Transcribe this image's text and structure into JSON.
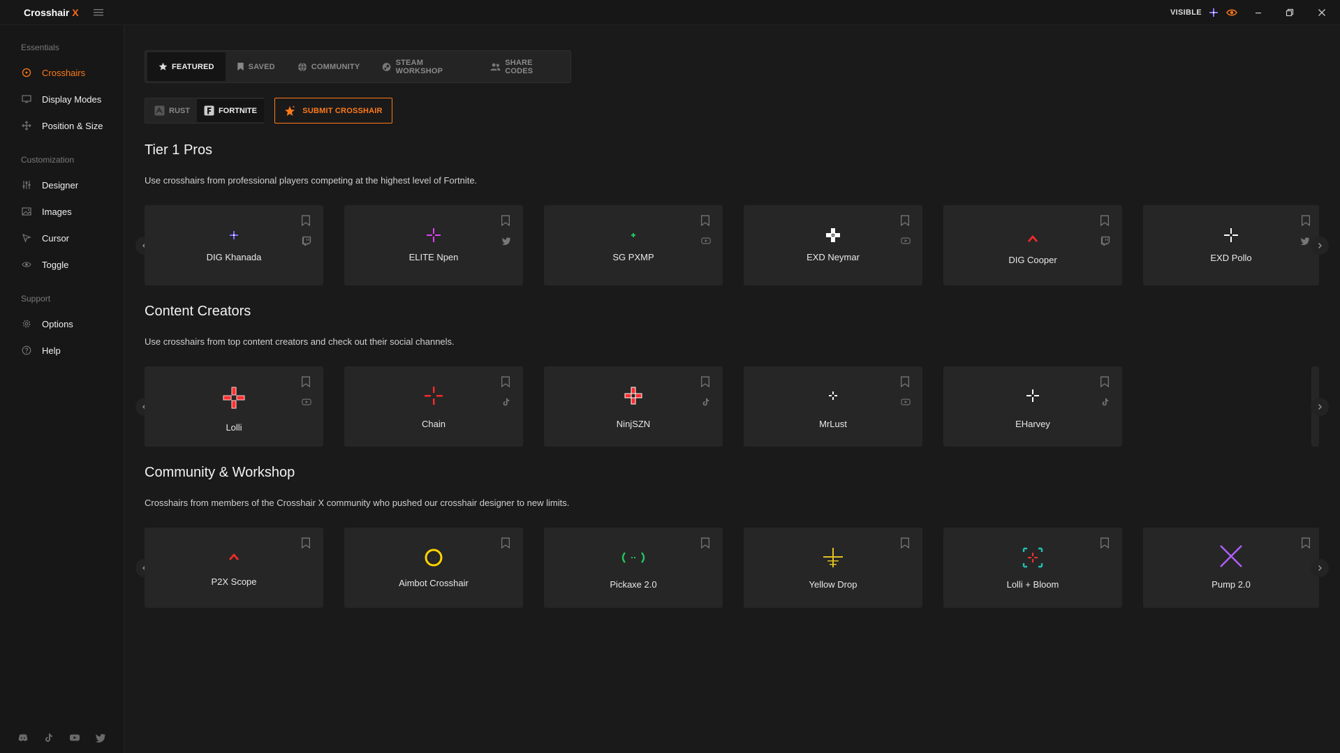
{
  "app": {
    "title": "Crosshair",
    "title_accent": "X",
    "visible_label": "VISIBLE"
  },
  "sidebar": {
    "sections": [
      {
        "label": "Essentials"
      },
      {
        "label": "Customization"
      },
      {
        "label": "Support"
      }
    ],
    "items": [
      {
        "label": "Crosshairs",
        "icon": "target-icon",
        "active": true
      },
      {
        "label": "Display Modes",
        "icon": "monitor-icon"
      },
      {
        "label": "Position & Size",
        "icon": "move-icon"
      },
      {
        "label": "Designer",
        "icon": "sliders-icon"
      },
      {
        "label": "Images",
        "icon": "image-icon"
      },
      {
        "label": "Cursor",
        "icon": "cursor-icon"
      },
      {
        "label": "Toggle",
        "icon": "eye-icon"
      },
      {
        "label": "Options",
        "icon": "gear-icon"
      },
      {
        "label": "Help",
        "icon": "help-icon"
      }
    ],
    "social": [
      "discord-icon",
      "tiktok-icon",
      "youtube-icon",
      "twitter-icon"
    ]
  },
  "tabs": [
    {
      "label": "FEATURED",
      "icon": "star-icon",
      "active": true
    },
    {
      "label": "SAVED",
      "icon": "bookmark-icon"
    },
    {
      "label": "COMMUNITY",
      "icon": "globe-icon"
    },
    {
      "label": "STEAM WORKSHOP",
      "icon": "steam-icon"
    },
    {
      "label": "SHARE CODES",
      "icon": "users-icon"
    }
  ],
  "games": [
    {
      "label": "RUST",
      "icon": "rust-icon"
    },
    {
      "label": "FORTNITE",
      "icon": "fortnite-icon",
      "active": true
    }
  ],
  "submit_label": "SUBMIT CROSSHAIR",
  "sections": [
    {
      "title": "Tier 1 Pros",
      "description": "Use crosshairs from professional players competing at the highest level of Fortnite.",
      "cards": [
        {
          "name": "DIG Khanada",
          "social": "twitch-icon",
          "color": "#7b6bff"
        },
        {
          "name": "ELITE Npen",
          "social": "twitter-icon",
          "color": "#e040fb"
        },
        {
          "name": "SG PXMP",
          "social": "youtube-icon",
          "color": "#22c55e"
        },
        {
          "name": "EXD Neymar",
          "social": "youtube-icon",
          "color": "#ffffff"
        },
        {
          "name": "DIG Cooper",
          "social": "twitch-icon",
          "color": "#ff2a2a"
        },
        {
          "name": "EXD Pollo",
          "social": "twitter-icon",
          "color": "#ffffff"
        }
      ]
    },
    {
      "title": "Content Creators",
      "description": "Use crosshairs from top content creators and check out their social channels.",
      "cards": [
        {
          "name": "Lolli",
          "social": "youtube-icon",
          "color": "#ff3030"
        },
        {
          "name": "Chain",
          "social": "tiktok-icon",
          "color": "#ff2a2a"
        },
        {
          "name": "NinjSZN",
          "social": "tiktok-icon",
          "color": "#ff2a2a"
        },
        {
          "name": "MrLust",
          "social": "youtube-icon",
          "color": "#ffffff"
        },
        {
          "name": "EHarvey",
          "social": "tiktok-icon",
          "color": "#ffffff"
        }
      ]
    },
    {
      "title": "Community & Workshop",
      "description": "Crosshairs from members of the Crosshair X community who pushed our crosshair designer to new limits.",
      "cards": [
        {
          "name": "P2X Scope",
          "color": "#ff2a2a"
        },
        {
          "name": "Aimbot Crosshair",
          "color": "#ffd400"
        },
        {
          "name": "Pickaxe 2.0",
          "color": "#22c55e"
        },
        {
          "name": "Yellow Drop",
          "color": "#e0c020"
        },
        {
          "name": "Lolli + Bloom",
          "color": "#20c0b0"
        },
        {
          "name": "Pump 2.0",
          "color": "#b060ff"
        }
      ]
    }
  ]
}
